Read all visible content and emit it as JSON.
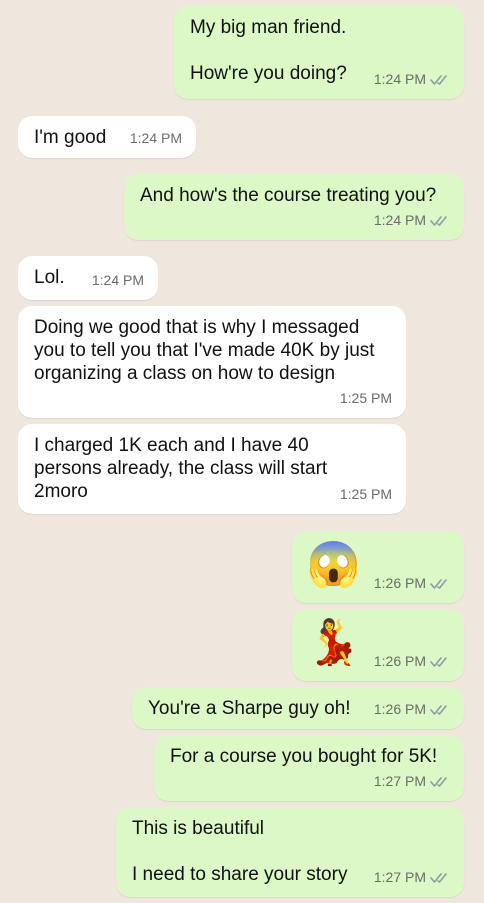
{
  "messages": [
    {
      "direction": "out",
      "text": "My big man friend.\n\nHow're you doing?",
      "time": "1:24 PM"
    },
    {
      "direction": "in",
      "text": "I'm good",
      "time": "1:24 PM"
    },
    {
      "direction": "out",
      "text": "And how's the course treating you?",
      "time": "1:24 PM"
    },
    {
      "direction": "in",
      "text": "Lol.",
      "time": "1:24 PM"
    },
    {
      "direction": "in",
      "text": "Doing we good that is why I messaged\nyou to tell you that I've made 40K by just\norganizing a class on how to design",
      "time": "1:25 PM"
    },
    {
      "direction": "in",
      "text": "I charged 1K each and I have 40\npersons already, the class will start\n2moro",
      "time": "1:25 PM"
    },
    {
      "direction": "out",
      "text": "😱",
      "time": "1:26 PM"
    },
    {
      "direction": "out",
      "text": "💃",
      "time": "1:26 PM"
    },
    {
      "direction": "out",
      "text": "You're a Sharpe guy oh!",
      "time": "1:26 PM"
    },
    {
      "direction": "out",
      "text": "For a course you bought for 5K!",
      "time": "1:27 PM"
    },
    {
      "direction": "out",
      "text": "This is beautiful\n\nI need to share your story",
      "time": "1:27 PM"
    }
  ],
  "icons": {
    "read_receipt": "double-check-icon"
  },
  "colors": {
    "outgoing": "#dcf8c6",
    "incoming": "#ffffff",
    "background": "#efe7de",
    "check": "#8f9aa3"
  }
}
